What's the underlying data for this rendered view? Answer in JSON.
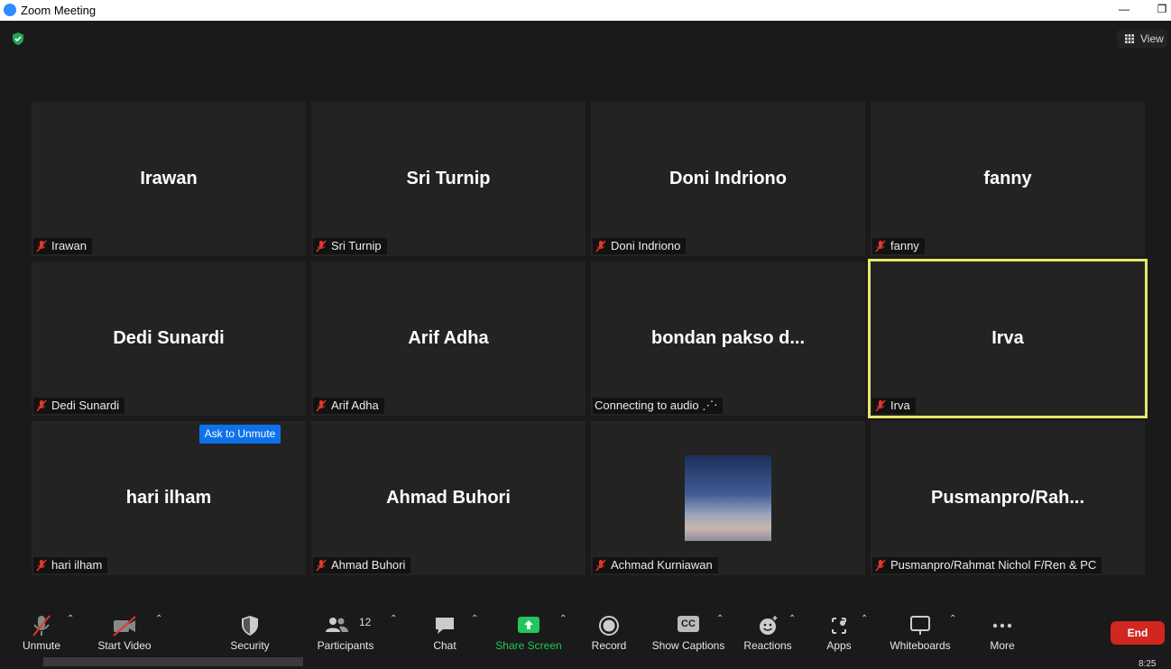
{
  "window": {
    "title": "Zoom Meeting",
    "minimize": "—",
    "restore": "❐"
  },
  "header": {
    "view_label": "View"
  },
  "tiles": [
    {
      "name": "Irawan",
      "label": "Irawan",
      "muted": true
    },
    {
      "name": "Sri Turnip",
      "label": "Sri Turnip",
      "muted": true
    },
    {
      "name": "Doni Indriono",
      "label": "Doni Indriono",
      "muted": true
    },
    {
      "name": "fanny",
      "label": "fanny",
      "muted": true
    },
    {
      "name": "Dedi Sunardi",
      "label": "Dedi Sunardi",
      "muted": true
    },
    {
      "name": "Arif Adha",
      "label": "Arif Adha",
      "muted": true
    },
    {
      "name": "bondan pakso d...",
      "label": "Connecting to audio ⋰⋅",
      "muted": false
    },
    {
      "name": "Irva",
      "label": "Irva",
      "muted": true,
      "active_speaker": true
    },
    {
      "name": "hari ilham",
      "label": "hari ilham",
      "muted": true,
      "ask_unmute": "Ask to Unmute"
    },
    {
      "name": "Ahmad Buhori",
      "label": "Ahmad Buhori",
      "muted": true
    },
    {
      "name": "",
      "label": "Achmad Kurniawan",
      "muted": true,
      "has_image": true
    },
    {
      "name": "Pusmanpro/Rah...",
      "label": "Pusmanpro/Rahmat Nichol F/Ren & PC",
      "muted": true
    }
  ],
  "toolbar": {
    "unmute": "Unmute",
    "start_video": "Start Video",
    "security": "Security",
    "participants": "Participants",
    "participants_count": "12",
    "chat": "Chat",
    "share_screen": "Share Screen",
    "record": "Record",
    "show_captions": "Show Captions",
    "reactions": "Reactions",
    "apps": "Apps",
    "whiteboards": "Whiteboards",
    "more": "More",
    "end": "End",
    "caret": "⌃",
    "cc_badge": "CC"
  },
  "taskbar": {
    "clock": "8:25"
  },
  "colors": {
    "accent": "#0e71eb",
    "share": "#22c55e",
    "end": "#d0271f",
    "active_border": "#e6e86a",
    "muted_red": "#e0372c"
  }
}
